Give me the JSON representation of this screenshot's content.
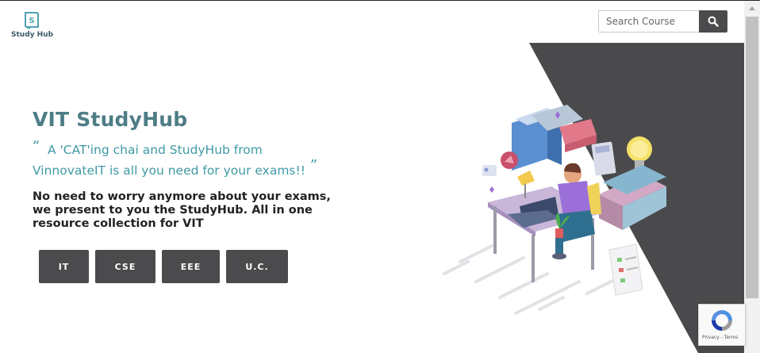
{
  "logo": {
    "text": "Study Hub"
  },
  "search": {
    "placeholder": "Search Course"
  },
  "hero": {
    "title": "VIT StudyHub",
    "quote_open": "“",
    "quote_line1": "A 'CAT'ing chai and StudyHub from",
    "quote_line2": "VinnovateIT is all you need for your exams!!",
    "quote_close": "”",
    "description": "No need to worry anymore about your exams, we present to you the StudyHub. All in one resource collection for VIT"
  },
  "courses": [
    "IT",
    "CSE",
    "EEE",
    "U.C."
  ],
  "recaptcha": {
    "links": "Privacy - Terms"
  },
  "colors": {
    "button": "#4b4b4d",
    "title": "#4e7d86",
    "quote": "#3f9aa5",
    "panel": "#4a4a4c"
  }
}
